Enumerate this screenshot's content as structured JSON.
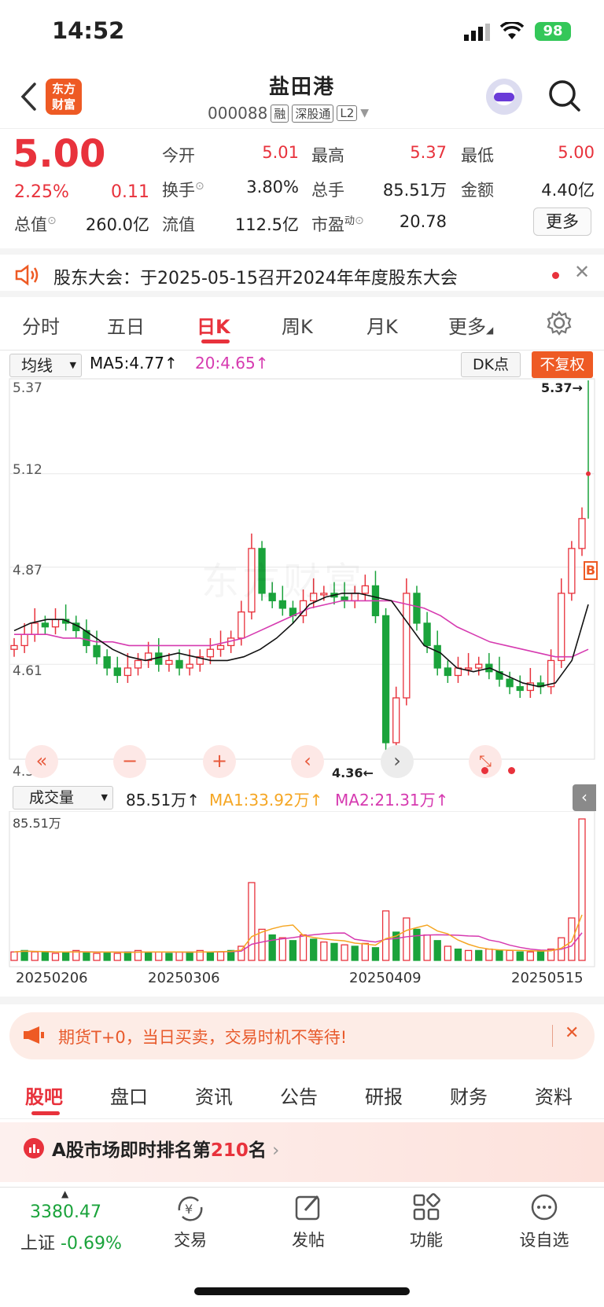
{
  "status": {
    "time": "14:52",
    "battery": "98"
  },
  "header": {
    "logo": "东方财富",
    "title": "盐田港",
    "code": "000088",
    "tags": [
      "融",
      "深股通",
      "L2"
    ]
  },
  "quote": {
    "price": "5.00",
    "change_pct": "2.25%",
    "change": "0.11",
    "fields": [
      {
        "label": "今开",
        "value": "5.01",
        "color": "red"
      },
      {
        "label": "最高",
        "value": "5.37",
        "color": "red"
      },
      {
        "label": "最低",
        "value": "5.00",
        "color": "red"
      },
      {
        "label": "换手",
        "value": "3.80%",
        "color": "black"
      },
      {
        "label": "总手",
        "value": "85.51万",
        "color": "black"
      },
      {
        "label": "金额",
        "value": "4.40亿",
        "color": "black"
      },
      {
        "label": "总值",
        "value": "260.0亿",
        "color": "black"
      },
      {
        "label": "流值",
        "value": "112.5亿",
        "color": "black"
      },
      {
        "label": "市盈",
        "value": "20.78",
        "color": "black"
      }
    ],
    "more_label": "更多",
    "pe_sup": "动"
  },
  "notice": {
    "text": "股东大会：于2025-05-15召开2024年年度股东大会"
  },
  "tabs": [
    "分时",
    "五日",
    "日K",
    "周K",
    "月K",
    "更多"
  ],
  "active_tab": "日K",
  "kchart": {
    "indicator": "均线",
    "ma5": "MA5:4.77",
    "ma20": "20:4.65",
    "dk_label": "DK点",
    "fq_label": "不复权",
    "y_ticks": [
      "5.37",
      "5.12",
      "4.87",
      "4.61",
      "4.36"
    ],
    "high_label": "5.37",
    "low_label": "4.36",
    "watermark": "东方财富",
    "marker": "B"
  },
  "chart_data": [
    {
      "type": "candlestick",
      "ylim": [
        4.36,
        5.37
      ],
      "series": [
        {
          "name": "MA5",
          "values": [
            4.7,
            4.72,
            4.73,
            4.73,
            4.71,
            4.68,
            4.65,
            4.63,
            4.62,
            4.63,
            4.64,
            4.63,
            4.62,
            4.62,
            4.63,
            4.65,
            4.68,
            4.72,
            4.77,
            4.79,
            4.8,
            4.8,
            4.79,
            4.78,
            4.72,
            4.66,
            4.64,
            4.6,
            4.59,
            4.6,
            4.58,
            4.56,
            4.55,
            4.56,
            4.62,
            4.77
          ]
        },
        {
          "name": "20",
          "values": [
            4.69,
            4.69,
            4.69,
            4.68,
            4.68,
            4.67,
            4.67,
            4.66,
            4.66,
            4.66,
            4.66,
            4.66,
            4.66,
            4.67,
            4.68,
            4.7,
            4.72,
            4.74,
            4.76,
            4.77,
            4.78,
            4.78,
            4.78,
            4.78,
            4.77,
            4.76,
            4.74,
            4.71,
            4.69,
            4.67,
            4.66,
            4.65,
            4.64,
            4.63,
            4.63,
            4.65
          ]
        }
      ]
    },
    {
      "type": "bar",
      "title": "成交量",
      "x": [
        "20250206",
        "20250306",
        "20250409",
        "20250515"
      ],
      "series": [
        {
          "name": "成交量",
          "last": "85.51万"
        },
        {
          "name": "MA1",
          "last": "33.92万"
        },
        {
          "name": "MA2",
          "last": "21.31万"
        }
      ],
      "ymax": "85.51万"
    }
  ],
  "volume": {
    "label": "成交量",
    "last": "85.51万",
    "ma1": "MA1:33.92万",
    "ma2": "MA2:21.31万",
    "ymax": "85.51万"
  },
  "dates": [
    "20250206",
    "20250306",
    "20250409",
    "20250515"
  ],
  "banner": {
    "text": "期货T+0，当日买卖，交易时机不等待!"
  },
  "bottom_tabs": [
    "股吧",
    "盘口",
    "资讯",
    "公告",
    "研报",
    "财务",
    "资料"
  ],
  "rank": {
    "prefix": "A股市场即时排名第",
    "num": "210",
    "suffix": "名"
  },
  "bottom_nav": {
    "index_value": "3380.47",
    "index_name": "上证",
    "index_change": "-0.69%",
    "items": [
      "交易",
      "发帖",
      "功能",
      "设自选"
    ]
  },
  "colors": {
    "up": "#e8323c",
    "down": "#1aa33b",
    "ma5": "#111111",
    "ma20": "#d63ab0",
    "ma1": "#f5a623",
    "accent": "#ee5a24"
  }
}
